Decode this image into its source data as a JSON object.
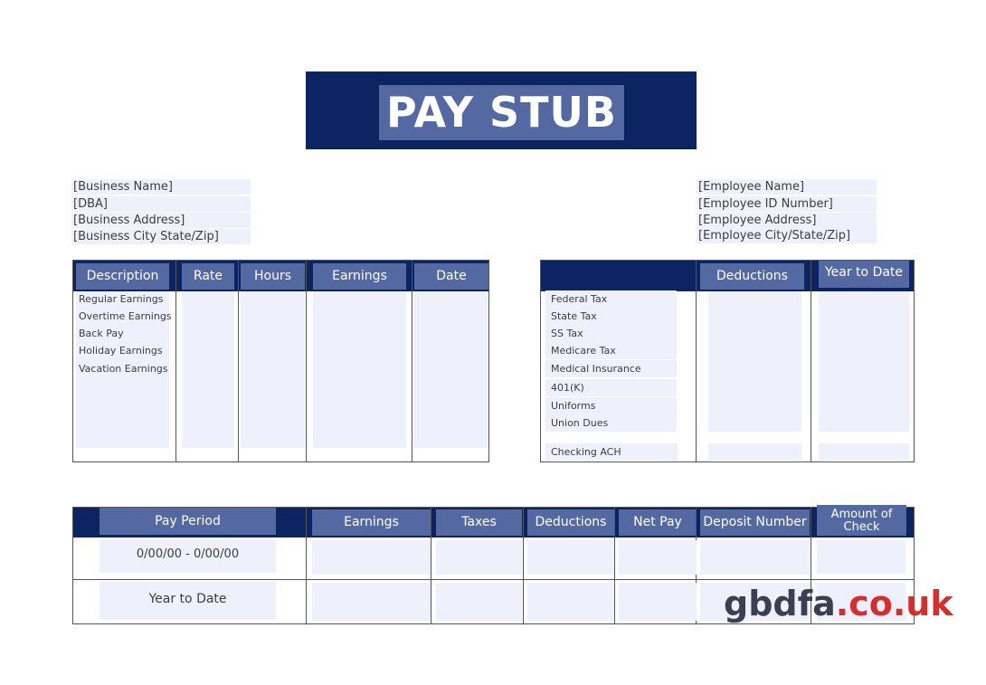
{
  "title": "PAY STUB",
  "business": [
    "[Business Name]",
    "[DBA]",
    "[Business Address]",
    "[Business City State/Zip]"
  ],
  "employee": [
    "[Employee Name]",
    "[Employee ID Number]",
    "[Employee Address]",
    "[Employee City/State/Zip]"
  ],
  "earnings_table": {
    "headers": [
      "Description",
      "Rate",
      "Hours",
      "Earnings",
      "Date"
    ],
    "rows": [
      "Regular Earnings",
      "Overtime Earnings",
      "Back Pay",
      "Holiday Earnings",
      "Vacation Earnings"
    ]
  },
  "deductions_table": {
    "headers": [
      "",
      "Deductions",
      "Year to Date"
    ],
    "rows": [
      "Federal Tax",
      "State Tax",
      "SS Tax",
      "Medicare Tax",
      "Medical Insurance",
      "401(K)",
      "Uniforms",
      "Union Dues"
    ],
    "last_row": "Checking ACH"
  },
  "summary_table": {
    "headers": [
      "Pay Period",
      "Earnings",
      "Taxes",
      "Deductions",
      "Net Pay",
      "Deposit Number",
      "Amount of Check"
    ],
    "rows": [
      "0/00/00 - 0/00/00",
      "Year to Date"
    ]
  },
  "watermark": {
    "part1": "gbdfa",
    "part2": ".co.uk"
  },
  "colors": {
    "navy": "#0c2461",
    "header_blue": "#5469a1",
    "cell_fill": "#eef0fb",
    "watermark_red": "#d32f2f"
  }
}
